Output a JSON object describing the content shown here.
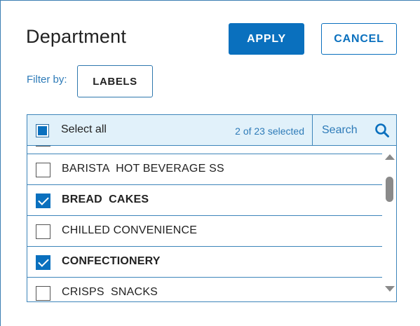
{
  "dialog": {
    "title": "Department",
    "apply_label": "APPLY",
    "cancel_label": "CANCEL",
    "filter_label": "Filter by:",
    "filter_button_label": "LABELS"
  },
  "list": {
    "select_all_label": "Select all",
    "select_all_state": "partial",
    "selected_count": "2 of 23 selected",
    "search_label": "Search",
    "items": [
      {
        "label": "",
        "checked": false
      },
      {
        "label": "BARISTA  HOT BEVERAGE SS",
        "checked": false
      },
      {
        "label": "BREAD  CAKES",
        "checked": true
      },
      {
        "label": "CHILLED CONVENIENCE",
        "checked": false
      },
      {
        "label": "CONFECTIONERY",
        "checked": true
      },
      {
        "label": "CRISPS  SNACKS",
        "checked": false
      }
    ]
  },
  "colors": {
    "accent": "#0a70be",
    "link_text": "#2e7bb8",
    "header_bg": "#e1f1fa",
    "border": "#3d85ba"
  },
  "icons": {
    "search": "search-icon",
    "scroll_up": "chevron-up-icon",
    "scroll_down": "chevron-down-icon"
  }
}
